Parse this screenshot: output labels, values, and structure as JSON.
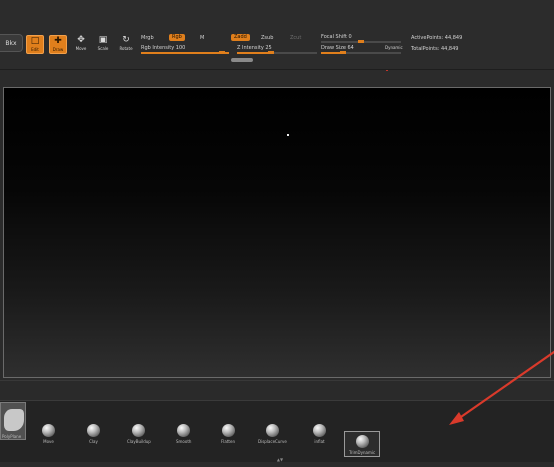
{
  "toolbar": {
    "left_button": "Bkx",
    "tools": [
      {
        "label": "Edit",
        "icon": "edit-icon",
        "active": true
      },
      {
        "label": "Draw",
        "icon": "draw-icon",
        "active": true
      },
      {
        "label": "Move",
        "icon": "move-icon",
        "active": false
      },
      {
        "label": "Scale",
        "icon": "scale-icon",
        "active": false
      },
      {
        "label": "Rotate",
        "icon": "rotate-icon",
        "active": false
      }
    ],
    "mrgb_label": "Mrgb",
    "rgb_label": "Rgb",
    "m_label": "M",
    "rgb_intensity_label": "Rgb Intensity 100",
    "zadd_label": "Zadd",
    "zsub_label": "Zsub",
    "zcut_label": "Zcut",
    "z_intensity_label": "Z Intensity 25",
    "focal_shift_label": "Focal Shift 0",
    "draw_size_label": "Draw Size 64",
    "dynamic_label": "Dynamic",
    "active_points_label": "ActivePoints: 44,849",
    "total_points_label": "TotalPoints: 44,849"
  },
  "brushes": [
    {
      "label": "Move"
    },
    {
      "label": "Clay"
    },
    {
      "label": "ClayBuildup"
    },
    {
      "label": "Smooth"
    },
    {
      "label": "Flatten"
    },
    {
      "label": "DisplaceCurve"
    },
    {
      "label": "inflat"
    },
    {
      "label": "TrimDynamic",
      "selected": true
    }
  ],
  "thumbnail_label": "PolyPlane",
  "scroll_label": "▲▼",
  "colors": {
    "accent": "#e07f1c",
    "panel": "#2c2c2c",
    "annotation_arrow": "#d93a2b"
  }
}
